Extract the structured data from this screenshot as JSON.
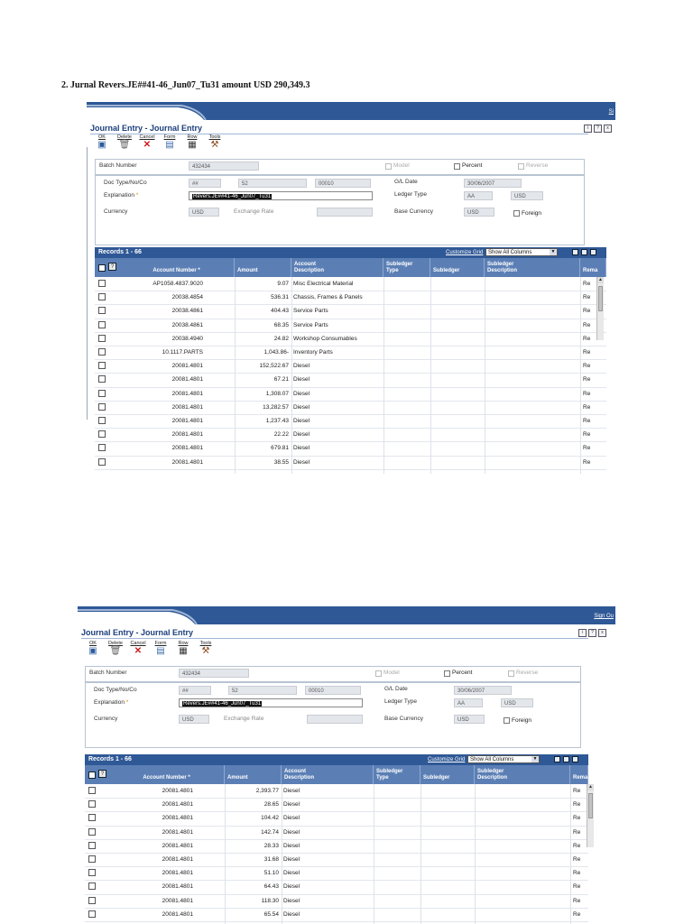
{
  "heading": "2. Jurnal Revers.JE##41-46_Jun07_Tu31  amount  USD 290,349.3",
  "screens": [
    {
      "signin": "Si",
      "window_title": "Journal Entry - Journal Entry",
      "title_icons": [
        "i",
        "?",
        "x"
      ],
      "toolbar": [
        {
          "label": "OK",
          "icon": "save-icon",
          "glyph": "▣"
        },
        {
          "label": "Delete",
          "icon": "trash-icon",
          "glyph": "🗑"
        },
        {
          "label": "Cancel",
          "icon": "cancel-x-icon",
          "glyph": "✕"
        },
        {
          "label": "Form",
          "icon": "form-icon",
          "glyph": "▤"
        },
        {
          "label": "Row",
          "icon": "grid-icon",
          "glyph": "▦"
        },
        {
          "label": "Tools",
          "icon": "tools-icon",
          "glyph": "⚒"
        }
      ],
      "batch": {
        "label": "Batch Number",
        "value": "432434",
        "model_label": "Model",
        "percent_label": "Percent",
        "reverse_label": "Reverse"
      },
      "form": {
        "doc_label": "Doc Type/No/Co",
        "doc_type": "##",
        "doc_no": "52",
        "doc_co": "00010",
        "gl_date_label": "G/L Date",
        "gl_date": "30/06/2007",
        "explanation_label": "Explanation",
        "required_marker": "*",
        "explanation": "Revers.JE##41-46_Jun07_Tu31",
        "ledger_label": "Ledger Type",
        "ledger_type": "AA",
        "ledger_currency": "USD",
        "currency_label": "Currency",
        "currency": "USD",
        "exchange_label": "Exchange Rate",
        "exchange_rate": "",
        "base_currency_label": "Base Currency",
        "base_currency": "USD",
        "foreign_label": "Foreign"
      },
      "grid": {
        "title": "Records 1 - 66",
        "customize": "Customize Grid",
        "show_select": "Show All Columns",
        "columns": {
          "account": "Account Number",
          "account_sort": "*",
          "amount": "Amount",
          "desc1": "Account",
          "desc2": "Description",
          "sltype1": "Subledger",
          "sltype2": "Type",
          "subledger": "Subledger",
          "sldesc1": "Subledger",
          "sldesc2": "Description",
          "remark": "Rema"
        },
        "rows": [
          {
            "account": "AP1058.4837.9020",
            "amount": "9.07",
            "desc": "Misc Electrical Material",
            "remark": "Re"
          },
          {
            "account": "20038.4854",
            "amount": "536.31",
            "desc": "Chassis, Frames & Panels",
            "remark": "Re"
          },
          {
            "account": "20038.4861",
            "amount": "404.43",
            "desc": "Service Parts",
            "remark": "Re"
          },
          {
            "account": "20038.4861",
            "amount": "68.35",
            "desc": "Service Parts",
            "remark": "Re"
          },
          {
            "account": "20038.4940",
            "amount": "24.82",
            "desc": "Workshop Consumables",
            "remark": "Re"
          },
          {
            "account": "10.1117.PARTS",
            "amount": "1,043.86-",
            "desc": "Inventory Parts",
            "remark": "Re"
          },
          {
            "account": "20081.4801",
            "amount": "152,522.67",
            "desc": "Diesel",
            "remark": "Re"
          },
          {
            "account": "20081.4801",
            "amount": "67.21",
            "desc": "Diesel",
            "remark": "Re"
          },
          {
            "account": "20081.4801",
            "amount": "1,308.07",
            "desc": "Diesel",
            "remark": "Re"
          },
          {
            "account": "20081.4801",
            "amount": "13,282.57",
            "desc": "Diesel",
            "remark": "Re"
          },
          {
            "account": "20081.4801",
            "amount": "1,237.43",
            "desc": "Diesel",
            "remark": "Re"
          },
          {
            "account": "20081.4801",
            "amount": "22.22",
            "desc": "Diesel",
            "remark": "Re"
          },
          {
            "account": "20081.4801",
            "amount": "679.81",
            "desc": "Diesel",
            "remark": "Re"
          },
          {
            "account": "20081.4801",
            "amount": "38.55",
            "desc": "Diesel",
            "remark": "Re"
          }
        ]
      }
    },
    {
      "signin": "Sign Ou",
      "window_title": "Journal Entry - Journal Entry",
      "title_icons": [
        "i",
        "?",
        "x"
      ],
      "toolbar": [
        {
          "label": "OK",
          "icon": "save-icon",
          "glyph": "▣"
        },
        {
          "label": "Delete",
          "icon": "trash-icon",
          "glyph": "🗑"
        },
        {
          "label": "Cancel",
          "icon": "cancel-x-icon",
          "glyph": "✕"
        },
        {
          "label": "Form",
          "icon": "form-icon",
          "glyph": "▤"
        },
        {
          "label": "Row",
          "icon": "grid-icon",
          "glyph": "▦"
        },
        {
          "label": "Tools",
          "icon": "tools-icon",
          "glyph": "⚒"
        }
      ],
      "batch": {
        "label": "Batch Number",
        "value": "432434",
        "model_label": "Model",
        "percent_label": "Percent",
        "reverse_label": "Reverse"
      },
      "form": {
        "doc_label": "Doc Type/No/Co",
        "doc_type": "##",
        "doc_no": "52",
        "doc_co": "00010",
        "gl_date_label": "G/L Date",
        "gl_date": "30/06/2007",
        "explanation_label": "Explanation",
        "required_marker": "*",
        "explanation": "Revers.JE##41-46_Jun07_Tu31",
        "ledger_label": "Ledger Type",
        "ledger_type": "AA",
        "ledger_currency": "USD",
        "currency_label": "Currency",
        "currency": "USD",
        "exchange_label": "Exchange Rate",
        "exchange_rate": "",
        "base_currency_label": "Base Currency",
        "base_currency": "USD",
        "foreign_label": "Foreign"
      },
      "grid": {
        "title": "Records 1 - 66",
        "customize": "Customize Grid",
        "show_select": "Show All Columns",
        "columns": {
          "account": "Account Number",
          "account_sort": "*",
          "amount": "Amount",
          "desc1": "Account",
          "desc2": "Description",
          "sltype1": "Subledger",
          "sltype2": "Type",
          "subledger": "Subledger",
          "sldesc1": "Subledger",
          "sldesc2": "Description",
          "remark": "Rema"
        },
        "rows": [
          {
            "account": "20081.4801",
            "amount": "2,393.77",
            "desc": "Diesel",
            "remark": "Re"
          },
          {
            "account": "20081.4801",
            "amount": "28.65",
            "desc": "Diesel",
            "remark": "Re"
          },
          {
            "account": "20081.4801",
            "amount": "104.42",
            "desc": "Diesel",
            "remark": "Re"
          },
          {
            "account": "20081.4801",
            "amount": "142.74",
            "desc": "Diesel",
            "remark": "Re"
          },
          {
            "account": "20081.4801",
            "amount": "28.33",
            "desc": "Diesel",
            "remark": "Re"
          },
          {
            "account": "20081.4801",
            "amount": "31.68",
            "desc": "Diesel",
            "remark": "Re"
          },
          {
            "account": "20081.4801",
            "amount": "51.10",
            "desc": "Diesel",
            "remark": "Re"
          },
          {
            "account": "20081.4801",
            "amount": "64.43",
            "desc": "Diesel",
            "remark": "Re"
          },
          {
            "account": "20081.4801",
            "amount": "118.30",
            "desc": "Diesel",
            "remark": "Re"
          },
          {
            "account": "20081.4801",
            "amount": "65.54",
            "desc": "Diesel",
            "remark": "Re"
          }
        ]
      }
    }
  ]
}
